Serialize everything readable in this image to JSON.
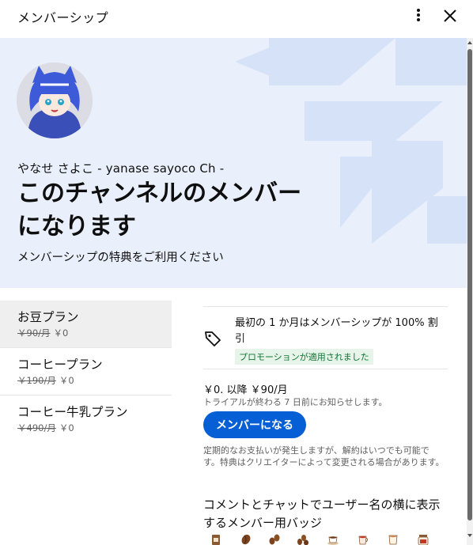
{
  "header": {
    "title": "メンバーシップ",
    "more_icon": "more-vert-icon",
    "close_icon": "close-icon"
  },
  "banner": {
    "channel_name": "やなせ さよこ - yanase sayoco Ch -",
    "title": "このチャンネルのメンバーになります",
    "subtitle": "メンバーシップの特典をご利用ください",
    "background_color": "#eaf0fb",
    "art_color": "#d6e2f8"
  },
  "tiers": [
    {
      "name": "お豆プラン",
      "original_price": "￥90/月",
      "price": "￥0",
      "selected": true
    },
    {
      "name": "コーヒープラン",
      "original_price": "￥190/月",
      "price": "￥0",
      "selected": false
    },
    {
      "name": "コーヒー牛乳プラン",
      "original_price": "￥490/月",
      "price": "￥0",
      "selected": false
    }
  ],
  "details": {
    "promo_text": "最初の 1 か月はメンバーシップが 100% 割引",
    "promo_badge": "プロモーションが適用されました",
    "price_line": "￥0. 以降 ￥90/月",
    "trial_note": "トライアルが終わる 7 日前にお知らせします。",
    "join_button": "メンバーになる",
    "disclaimer": "定期的なお支払いが発生しますが、解約はいつでも可能です。特典はクリエイターによって変更される場合があります。",
    "badges_heading": "コメントとチャットでユーザー名の横に表示するメンバー用バッジ",
    "badges": [
      "coffee-bag-icon",
      "coffee-bean-icon",
      "coffee-beans-icon",
      "coffee-beans-pile-icon",
      "coffee-cup-icon",
      "coffee-mug-icon",
      "coffee-latte-icon",
      "coffee-jar-icon"
    ]
  },
  "colors": {
    "accent": "#065fd4",
    "promo_badge_bg": "#e6f4ea",
    "promo_badge_text": "#137333"
  }
}
